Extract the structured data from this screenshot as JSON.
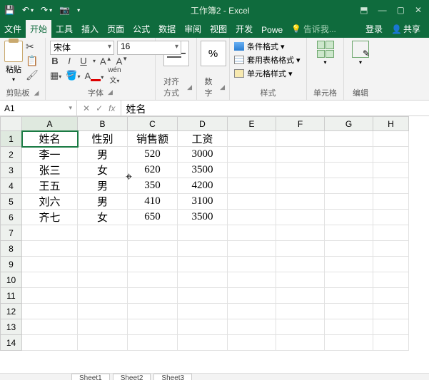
{
  "app": {
    "title": "工作簿2 - Excel"
  },
  "qat": {
    "save": "💾",
    "undo": "↶",
    "redo": "↷",
    "camera": "📷"
  },
  "win": {
    "min": "—",
    "max": "▢",
    "close": "✕",
    "restore": "⬒"
  },
  "tabs": {
    "file": "文件",
    "home": "开始",
    "tools": "工具",
    "insert": "插入",
    "page": "页面",
    "formula": "公式",
    "data": "数据",
    "review": "审阅",
    "view": "视图",
    "dev": "开发",
    "power": "Powe",
    "tellme_placeholder": "告诉我...",
    "login": "登录",
    "share": "共享"
  },
  "ribbon": {
    "clipboard": {
      "paste": "粘贴",
      "label": "剪贴板"
    },
    "font": {
      "name": "宋体",
      "size": "16",
      "label": "字体"
    },
    "alignment": {
      "label": "对齐方式"
    },
    "number": {
      "symbol": "%",
      "label": "数字"
    },
    "styles": {
      "conditional": "条件格式 ▾",
      "tableformat": "套用表格格式 ▾",
      "cellstyle": "单元格样式 ▾",
      "label": "样式"
    },
    "cells": {
      "label": "单元格"
    },
    "editing": {
      "label": "编辑"
    }
  },
  "namebox": {
    "value": "A1"
  },
  "formula": {
    "value": "姓名"
  },
  "columns": [
    "A",
    "B",
    "C",
    "D",
    "E",
    "F",
    "G",
    "H"
  ],
  "rows": [
    "1",
    "2",
    "3",
    "4",
    "5",
    "6",
    "7",
    "8",
    "9",
    "10",
    "11",
    "12",
    "13",
    "14"
  ],
  "data": {
    "r1": {
      "a": "姓名",
      "b": "性别",
      "c": "销售额",
      "d": "工资"
    },
    "r2": {
      "a": "李一",
      "b": "男",
      "c": "520",
      "d": "3000"
    },
    "r3": {
      "a": "张三",
      "b": "女",
      "c": "620",
      "d": "3500"
    },
    "r4": {
      "a": "王五",
      "b": "男",
      "c": "350",
      "d": "4200"
    },
    "r5": {
      "a": "刘六",
      "b": "男",
      "c": "410",
      "d": "3100"
    },
    "r6": {
      "a": "齐七",
      "b": "女",
      "c": "650",
      "d": "3500"
    }
  },
  "sheets": {
    "s1": "Sheet1",
    "s2": "Sheet2",
    "s3": "Sheet3"
  }
}
